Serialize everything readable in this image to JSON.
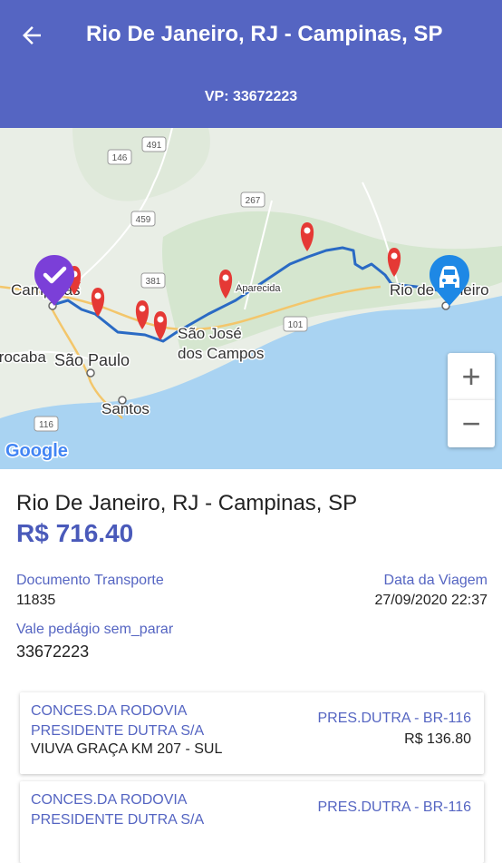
{
  "header": {
    "title": "Rio De Janeiro, RJ - Campinas, SP",
    "subtitle": "VP: 33672223",
    "background": "#5565c2"
  },
  "map": {
    "places": {
      "campinas": "Campinas",
      "rio": "Rio de Janeiro",
      "sorocaba": "Sorocaba",
      "sao_paulo": "São Paulo",
      "santos": "Santos",
      "sjc_1": "São José",
      "sjc_2": "dos Campos",
      "aparecida": "Aparecida"
    },
    "shields": [
      "491",
      "146",
      "459",
      "267",
      "381",
      "101",
      "116"
    ],
    "attribution": "Google",
    "zoom_in": "+",
    "zoom_out": "−",
    "route_color": "#2a6ac4",
    "toll_marker_color": "#e53935",
    "origin_marker_color": "#7b3fd8",
    "destination_marker_color": "#1e88e5",
    "icons": [
      "check-icon",
      "car-icon",
      "toll-marker-icon"
    ]
  },
  "details": {
    "route": "Rio De Janeiro, RJ - Campinas, SP",
    "amount": "R$ 716.40",
    "doc_label": "Documento Transporte",
    "doc_value": "11835",
    "date_label": "Data da Viagem",
    "date_value": "27/09/2020 22:37",
    "vp_label": "Vale pedágio sem_parar",
    "vp_value": "33672223"
  },
  "tolls": [
    {
      "company_line1": "CONCES.DA RODOVIA",
      "company_line2": "PRESIDENTE DUTRA S/A",
      "place": "VIUVA GRAÇA KM 207 - SUL",
      "road": "PRES.DUTRA - BR-116",
      "value": "R$ 136.80"
    },
    {
      "company_line1": "CONCES.DA RODOVIA",
      "company_line2": "PRESIDENTE DUTRA S/A",
      "road": "PRES.DUTRA - BR-116"
    }
  ]
}
